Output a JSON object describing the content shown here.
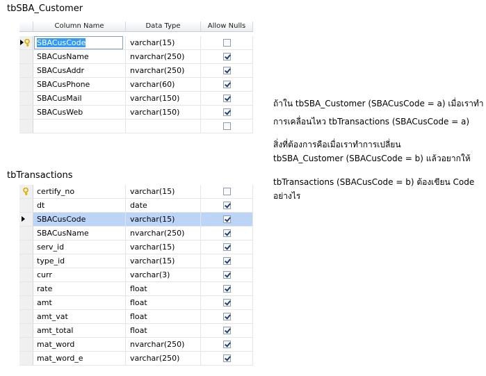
{
  "customer_table": {
    "caption": "tbSBA_Customer",
    "headers": {
      "column_name": "Column Name",
      "data_type": "Data Type",
      "allow_nulls": "Allow Nulls"
    },
    "rows": [
      {
        "name": "SBACusCode",
        "type": "varchar(15)",
        "allow_nulls": false,
        "primary_key": true,
        "current": true,
        "editing": true
      },
      {
        "name": "SBACusName",
        "type": "nvarchar(250)",
        "allow_nulls": true
      },
      {
        "name": "SBACusAddr",
        "type": "nvarchar(250)",
        "allow_nulls": true
      },
      {
        "name": "SBACusPhone",
        "type": "varchar(60)",
        "allow_nulls": true
      },
      {
        "name": "SBACusMail",
        "type": "varchar(150)",
        "allow_nulls": true
      },
      {
        "name": "SBACusWeb",
        "type": "varchar(150)",
        "allow_nulls": true
      },
      {
        "name": "",
        "type": "",
        "allow_nulls": false
      }
    ]
  },
  "transactions_table": {
    "caption": "tbTransactions",
    "rows": [
      {
        "name": "certify_no",
        "type": "varchar(15)",
        "allow_nulls": false,
        "primary_key": true
      },
      {
        "name": "dt",
        "type": "date",
        "allow_nulls": true
      },
      {
        "name": "SBACusCode",
        "type": "varchar(15)",
        "allow_nulls": true,
        "current": true,
        "selected": true
      },
      {
        "name": "SBACusName",
        "type": "nvarchar(250)",
        "allow_nulls": true
      },
      {
        "name": "serv_id",
        "type": "varchar(15)",
        "allow_nulls": true
      },
      {
        "name": "type_id",
        "type": "varchar(15)",
        "allow_nulls": true
      },
      {
        "name": "curr",
        "type": "varchar(3)",
        "allow_nulls": true
      },
      {
        "name": "rate",
        "type": "float",
        "allow_nulls": true
      },
      {
        "name": "amt",
        "type": "float",
        "allow_nulls": true
      },
      {
        "name": "amt_vat",
        "type": "float",
        "allow_nulls": true
      },
      {
        "name": "amt_total",
        "type": "float",
        "allow_nulls": true
      },
      {
        "name": "mat_word",
        "type": "nvarchar(250)",
        "allow_nulls": true
      },
      {
        "name": "mat_word_e",
        "type": "varchar(250)",
        "allow_nulls": true
      }
    ]
  },
  "notes": [
    "ถ้าใน tbSBA_Customer (SBACusCode = a) เมื่อเราทำ",
    "การเคลื่อนไหว tbTransactions (SBACusCode = a)",
    "สิ่งที่ต้องการคือเมื่อเราทำการเปลี่ยน",
    "tbSBA_Customer (SBACusCode = b) แล้วอยากให้",
    "tbTransactions (SBACusCode = b) ต้องเขียน Code",
    "อย่างไร"
  ],
  "colors": {
    "selection": "#bcd5f7",
    "edit_highlight": "#3399ff",
    "key_icon": "#e0b000"
  }
}
